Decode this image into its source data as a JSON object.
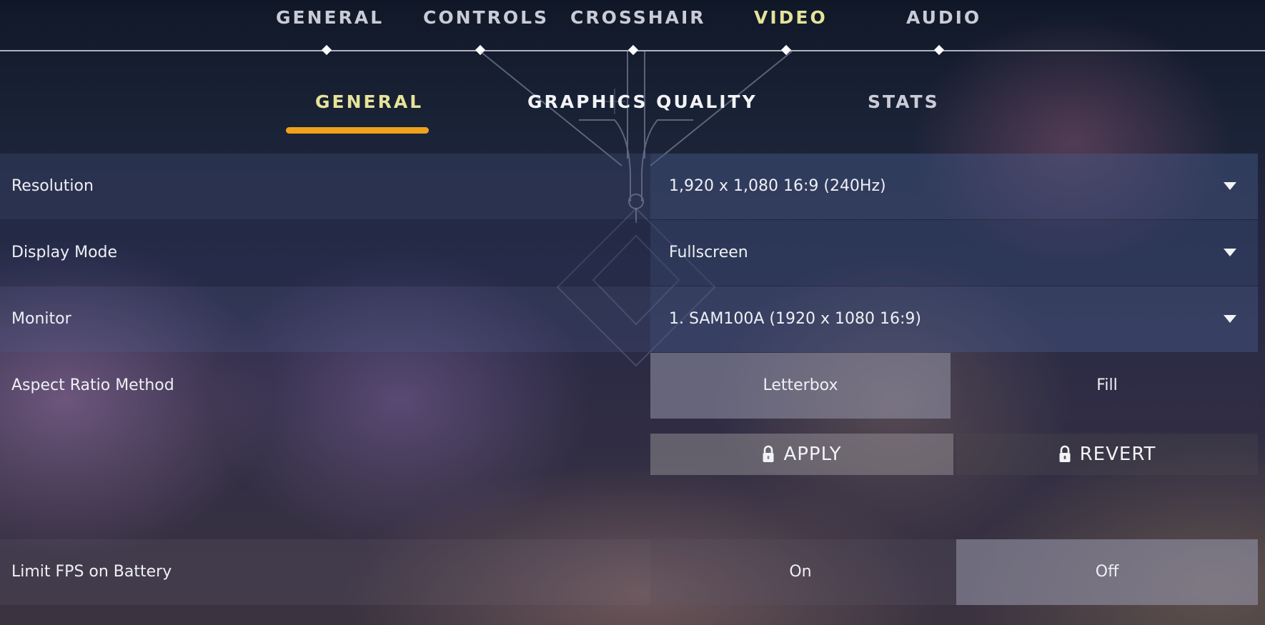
{
  "top_nav": {
    "tabs": [
      {
        "label": "GENERAL",
        "active": false
      },
      {
        "label": "CONTROLS",
        "active": false
      },
      {
        "label": "CROSSHAIR",
        "active": false
      },
      {
        "label": "VIDEO",
        "active": true
      },
      {
        "label": "AUDIO",
        "active": false
      }
    ]
  },
  "sub_nav": {
    "tabs": [
      {
        "label": "GENERAL",
        "active": true
      },
      {
        "label": "GRAPHICS QUALITY",
        "active": false
      },
      {
        "label": "STATS",
        "active": false
      }
    ]
  },
  "settings": {
    "resolution": {
      "label": "Resolution",
      "value": "1,920 x 1,080 16:9 (240Hz)"
    },
    "display_mode": {
      "label": "Display Mode",
      "value": "Fullscreen"
    },
    "monitor": {
      "label": "Monitor",
      "value": "1. SAM100A (1920 x  1080 16:9)"
    },
    "aspect_ratio": {
      "label": "Aspect Ratio Method",
      "options": [
        "Letterbox",
        "Fill"
      ],
      "selected": "Letterbox"
    },
    "limit_fps_battery": {
      "label": "Limit FPS on Battery",
      "options": [
        "On",
        "Off"
      ],
      "selected": "Off"
    }
  },
  "actions": {
    "apply_label": "APPLY",
    "revert_label": "REVERT"
  },
  "colors": {
    "accent_underline": "#f0a11c",
    "active_tab": "#e6e39a",
    "text": "#eef0f4"
  },
  "icons": {
    "dropdown": "caret-down-icon",
    "lock": "lock-icon",
    "nav_marker": "diamond-icon"
  }
}
